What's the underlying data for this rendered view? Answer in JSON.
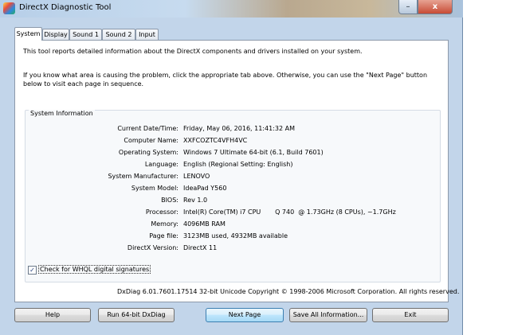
{
  "window": {
    "title": "DirectX Diagnostic Tool",
    "minimize_symbol": "–",
    "close_symbol": "x",
    "icon": "directx-icon"
  },
  "tabs": [
    {
      "label": "System",
      "active": true
    },
    {
      "label": "Display",
      "active": false
    },
    {
      "label": "Sound 1",
      "active": false
    },
    {
      "label": "Sound 2",
      "active": false
    },
    {
      "label": "Input",
      "active": false
    }
  ],
  "intro": {
    "line1": "This tool reports detailed information about the DirectX components and drivers installed on your system.",
    "line2": "If you know what area is causing the problem, click the appropriate tab above.  Otherwise, you can use the \"Next Page\" button below to visit each page in sequence."
  },
  "system_info": {
    "heading": "System Information",
    "rows": [
      {
        "label": "Current Date/Time:",
        "value": "Friday, May 06, 2016, 11:41:32 AM"
      },
      {
        "label": "Computer Name:",
        "value": "XXFCOZTC4VFH4VC"
      },
      {
        "label": "Operating System:",
        "value": "Windows 7 Ultimate 64-bit (6.1, Build 7601)"
      },
      {
        "label": "Language:",
        "value": "English (Regional Setting: English)"
      },
      {
        "label": "System Manufacturer:",
        "value": "LENOVO"
      },
      {
        "label": "System Model:",
        "value": "IdeaPad Y560"
      },
      {
        "label": "BIOS:",
        "value": "Rev 1.0"
      },
      {
        "label": "Processor:",
        "value": "Intel(R) Core(TM) i7 CPU       Q 740  @ 1.73GHz (8 CPUs), ~1.7GHz"
      },
      {
        "label": "Memory:",
        "value": "4096MB RAM"
      },
      {
        "label": "Page file:",
        "value": "3123MB used, 4932MB available"
      },
      {
        "label": "DirectX Version:",
        "value": "DirectX 11"
      }
    ]
  },
  "whql": {
    "label": "Check for WHQL digital signatures",
    "checked": true,
    "check_symbol": "✓"
  },
  "footer": {
    "version_text": "DxDiag 6.01.7601.17514 32-bit Unicode  Copyright © 1998-2006 Microsoft Corporation.  All rights reserved."
  },
  "buttons": {
    "help": "Help",
    "run64": "Run 64-bit DxDiag",
    "next_page": "Next Page",
    "save_all": "Save All Information...",
    "exit": "Exit"
  }
}
